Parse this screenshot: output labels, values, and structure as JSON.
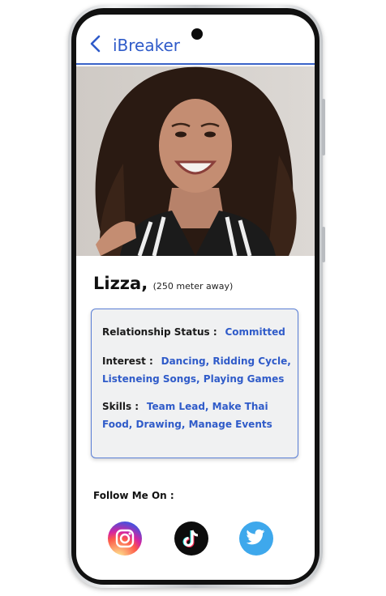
{
  "header": {
    "title": "iBreaker",
    "back_icon": "chevron-left-icon"
  },
  "profile": {
    "name": "Lizza,",
    "distance": "(250 meter away)",
    "photo": "profile-photo"
  },
  "details": {
    "relationship_label": "Relationship Status :",
    "relationship_value": "Committed",
    "interest_label": "Interest :",
    "interest_value": "Dancing, Ridding Cycle, Listeneing Songs, Playing Games",
    "skills_label": "Skills :",
    "skills_value": "Team Lead, Make Thai Food, Drawing, Manage Events"
  },
  "follow": {
    "label": "Follow Me On :",
    "icons": [
      "instagram-icon",
      "tiktok-icon",
      "twitter-icon"
    ]
  },
  "colors": {
    "accent": "#2f5bc9",
    "card_bg": "#f0f1f2",
    "card_border": "#5a7fd6",
    "twitter": "#3ea8ec"
  }
}
